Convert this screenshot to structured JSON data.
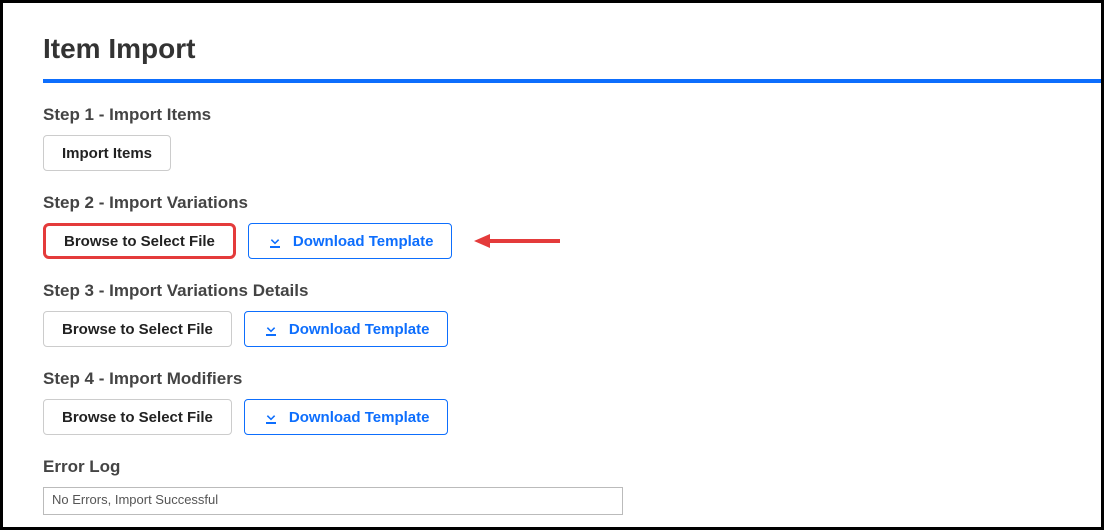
{
  "page": {
    "title": "Item Import"
  },
  "steps": [
    {
      "heading": "Step 1 - Import Items",
      "primary_button": "Import Items",
      "download_button": null,
      "highlighted": false,
      "arrow": false
    },
    {
      "heading": "Step 2 - Import Variations",
      "primary_button": "Browse to Select File",
      "download_button": "Download Template",
      "highlighted": true,
      "arrow": true
    },
    {
      "heading": "Step 3 - Import Variations Details",
      "primary_button": "Browse to Select File",
      "download_button": "Download Template",
      "highlighted": false,
      "arrow": false
    },
    {
      "heading": "Step 4 - Import Modifiers",
      "primary_button": "Browse to Select File",
      "download_button": "Download Template",
      "highlighted": false,
      "arrow": false
    }
  ],
  "error_log": {
    "heading": "Error Log",
    "content": "No Errors, Import Successful"
  },
  "colors": {
    "accent_blue": "#0d6efd",
    "annotation_red": "#e43b3b"
  }
}
